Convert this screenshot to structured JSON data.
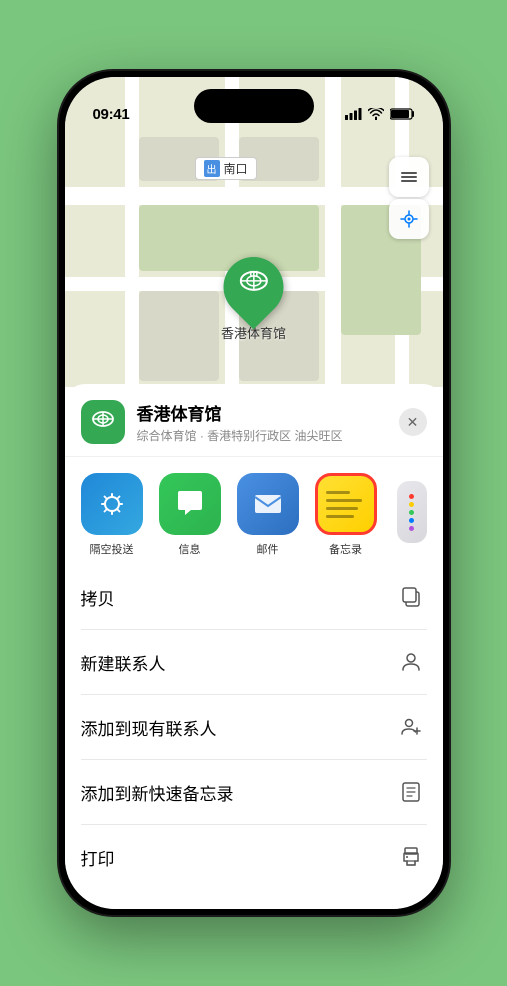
{
  "status_bar": {
    "time": "09:41",
    "navigation_arrow": "▶"
  },
  "map": {
    "label": "南口",
    "marker_label": "香港体育馆",
    "map_btn_layers": "🗺",
    "map_btn_location": "↗"
  },
  "location_card": {
    "name": "香港体育馆",
    "subtitle": "综合体育馆 · 香港特别行政区 油尖旺区",
    "close_label": "✕"
  },
  "share_apps": [
    {
      "id": "airdrop",
      "label": "隔空投送",
      "type": "airdrop"
    },
    {
      "id": "messages",
      "label": "信息",
      "type": "messages"
    },
    {
      "id": "mail",
      "label": "邮件",
      "type": "mail"
    },
    {
      "id": "notes",
      "label": "备忘录",
      "type": "notes"
    }
  ],
  "action_items": [
    {
      "id": "copy",
      "label": "拷贝",
      "icon": "copy"
    },
    {
      "id": "new-contact",
      "label": "新建联系人",
      "icon": "person"
    },
    {
      "id": "add-contact",
      "label": "添加到现有联系人",
      "icon": "person-add"
    },
    {
      "id": "add-notes",
      "label": "添加到新快速备忘录",
      "icon": "notes"
    },
    {
      "id": "print",
      "label": "打印",
      "icon": "printer"
    }
  ]
}
